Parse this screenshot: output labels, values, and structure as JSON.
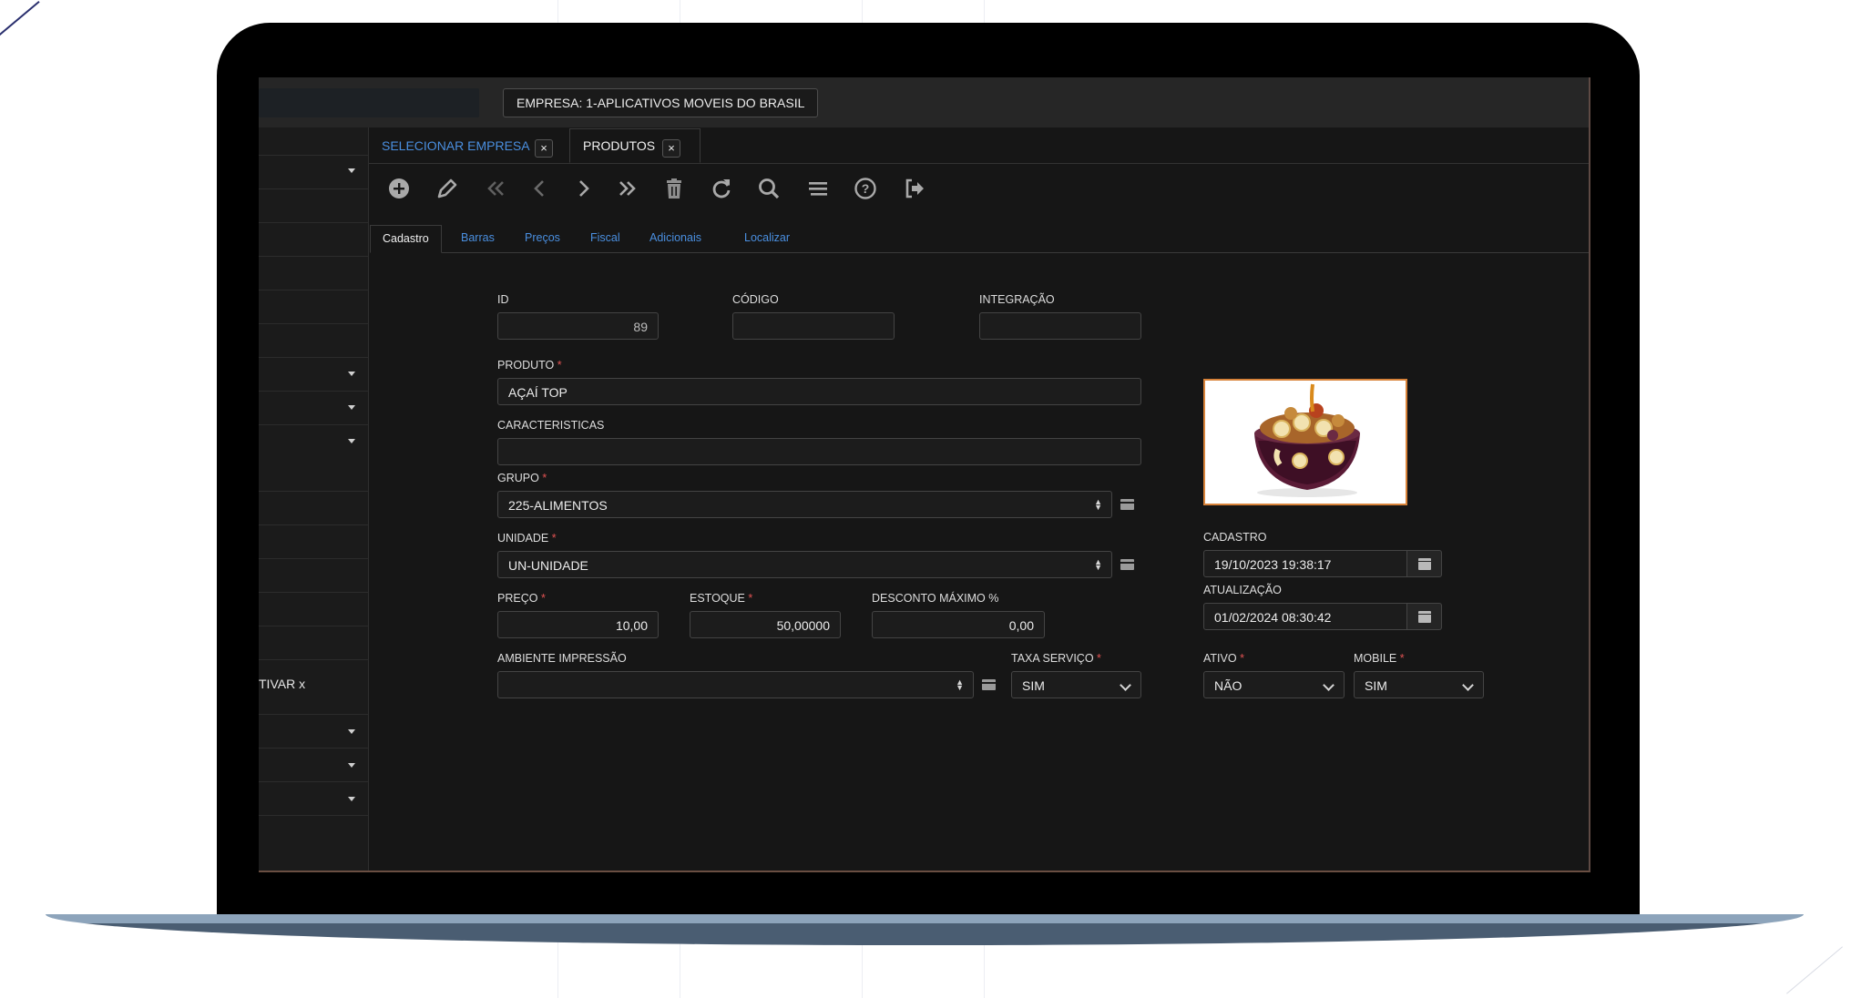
{
  "header": {
    "company_label": "EMPRESA: 1-APLICATIVOS MOVEIS DO BRASIL"
  },
  "sidebar": {
    "partial_text": "TIVAR x"
  },
  "tabs": [
    {
      "label": "SELECIONAR EMPRESA",
      "active": false,
      "close": "×"
    },
    {
      "label": "PRODUTOS",
      "active": true,
      "close": "×"
    }
  ],
  "toolbar": {
    "icons": [
      "add-icon",
      "edit-icon",
      "first-icon",
      "previous-icon",
      "next-icon",
      "last-icon",
      "delete-icon",
      "refresh-icon",
      "search-icon",
      "list-icon",
      "help-icon",
      "exit-icon"
    ]
  },
  "subtabs": [
    "Cadastro",
    "Barras",
    "Preços",
    "Fiscal",
    "Adicionais",
    "Localizar"
  ],
  "form": {
    "id": {
      "label": "ID",
      "value": "89"
    },
    "codigo": {
      "label": "CÓDIGO",
      "value": ""
    },
    "integracao": {
      "label": "INTEGRAÇÃO",
      "value": ""
    },
    "produto": {
      "label": "PRODUTO",
      "value": "AÇAÍ TOP"
    },
    "caracteristicas": {
      "label": "CARACTERISTICAS",
      "value": ""
    },
    "grupo": {
      "label": "GRUPO",
      "value": "225-ALIMENTOS"
    },
    "unidade": {
      "label": "UNIDADE",
      "value": "UN-UNIDADE"
    },
    "preco": {
      "label": "PREÇO",
      "value": "10,00"
    },
    "estoque": {
      "label": "ESTOQUE",
      "value": "50,00000"
    },
    "desconto": {
      "label": "DESCONTO MÁXIMO %",
      "value": "0,00"
    },
    "ambiente": {
      "label": "AMBIENTE IMPRESSÃO",
      "value": ""
    },
    "taxa_servico": {
      "label": "TAXA SERVIÇO",
      "value": "SIM"
    },
    "cadastro": {
      "label": "CADASTRO",
      "value": "19/10/2023 19:38:17"
    },
    "atualizacao": {
      "label": "ATUALIZAÇÃO",
      "value": "01/02/2024 08:30:42"
    },
    "ativo": {
      "label": "ATIVO",
      "value": "NÃO"
    },
    "mobile": {
      "label": "MOBILE",
      "value": "SIM"
    },
    "required_mark": "*"
  },
  "colors": {
    "accent_link": "#4a8fe0",
    "required": "#e05252",
    "photo_border": "#d8833a"
  }
}
